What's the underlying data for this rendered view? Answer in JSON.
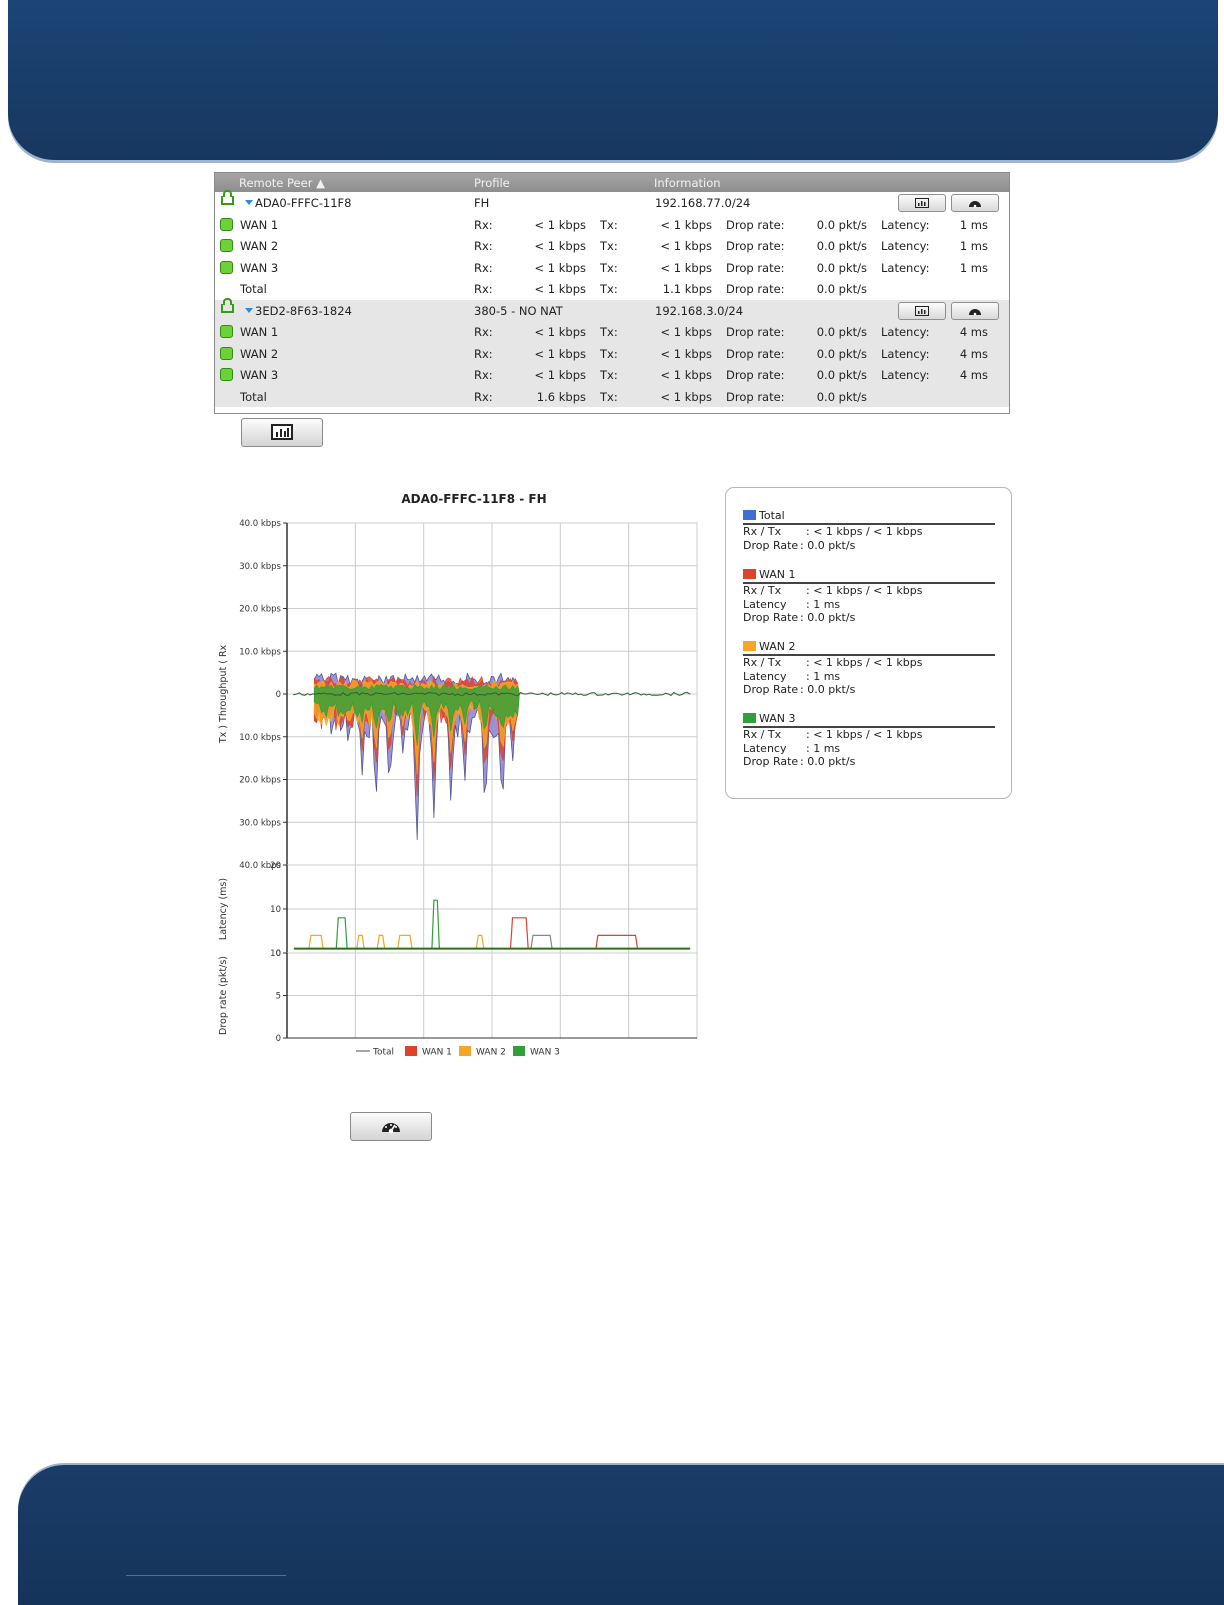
{
  "table": {
    "headers": [
      "Remote Peer",
      "Profile",
      "Information"
    ],
    "peers": [
      {
        "name": "ADA0-FFFC-11F8",
        "profile": "FH",
        "info": "192.168.77.0/24",
        "rows": [
          {
            "name": "WAN 1",
            "rx_label": "Rx:",
            "rx": "< 1 kbps",
            "tx_label": "Tx:",
            "tx": "< 1 kbps",
            "drop_label": "Drop rate:",
            "drop": "0.0 pkt/s",
            "lat_label": "Latency:",
            "lat": "1 ms"
          },
          {
            "name": "WAN 2",
            "rx_label": "Rx:",
            "rx": "< 1 kbps",
            "tx_label": "Tx:",
            "tx": "< 1 kbps",
            "drop_label": "Drop rate:",
            "drop": "0.0 pkt/s",
            "lat_label": "Latency:",
            "lat": "1 ms"
          },
          {
            "name": "WAN 3",
            "rx_label": "Rx:",
            "rx": "< 1 kbps",
            "tx_label": "Tx:",
            "tx": "< 1 kbps",
            "drop_label": "Drop rate:",
            "drop": "0.0 pkt/s",
            "lat_label": "Latency:",
            "lat": "1 ms"
          },
          {
            "name": "Total",
            "rx_label": "Rx:",
            "rx": "< 1 kbps",
            "tx_label": "Tx:",
            "tx": "1.1 kbps",
            "drop_label": "Drop rate:",
            "drop": "0.0 pkt/s",
            "lat_label": "",
            "lat": ""
          }
        ]
      },
      {
        "name": "3ED2-8F63-1824",
        "profile": "380-5 - NO NAT",
        "info": "192.168.3.0/24",
        "rows": [
          {
            "name": "WAN 1",
            "rx_label": "Rx:",
            "rx": "< 1 kbps",
            "tx_label": "Tx:",
            "tx": "< 1 kbps",
            "drop_label": "Drop rate:",
            "drop": "0.0 pkt/s",
            "lat_label": "Latency:",
            "lat": "4 ms"
          },
          {
            "name": "WAN 2",
            "rx_label": "Rx:",
            "rx": "< 1 kbps",
            "tx_label": "Tx:",
            "tx": "< 1 kbps",
            "drop_label": "Drop rate:",
            "drop": "0.0 pkt/s",
            "lat_label": "Latency:",
            "lat": "4 ms"
          },
          {
            "name": "WAN 3",
            "rx_label": "Rx:",
            "rx": "< 1 kbps",
            "tx_label": "Tx:",
            "tx": "< 1 kbps",
            "drop_label": "Drop rate:",
            "drop": "0.0 pkt/s",
            "lat_label": "Latency:",
            "lat": "4 ms"
          },
          {
            "name": "Total",
            "rx_label": "Rx:",
            "rx": "1.6 kbps",
            "tx_label": "Tx:",
            "tx": "< 1 kbps",
            "drop_label": "Drop rate:",
            "drop": "0.0 pkt/s",
            "lat_label": "",
            "lat": ""
          }
        ]
      }
    ]
  },
  "icons": {
    "chart_button": "bar-chart-icon",
    "gauge_button": "speedometer-icon"
  },
  "colors": {
    "total": "#4a6fcf",
    "wan1": "#e0412a",
    "wan2": "#f5a623",
    "wan3": "#2fa03a",
    "grid": "#cccccc"
  },
  "legend_panel": {
    "sections": [
      {
        "title": "Total",
        "color": "#3f6fd0",
        "lines": [
          {
            "k": "Rx / Tx",
            "v": ": < 1 kbps / < 1 kbps"
          },
          {
            "k": "Drop Rate",
            "v": ": 0.0 pkt/s",
            "inline": true
          }
        ]
      },
      {
        "title": "WAN 1",
        "color": "#e0412a",
        "lines": [
          {
            "k": "Rx / Tx",
            "v": ": < 1 kbps / < 1 kbps"
          },
          {
            "k": "Latency",
            "v": ": 1 ms"
          },
          {
            "k": "Drop Rate",
            "v": ": 0.0 pkt/s",
            "inline": true
          }
        ]
      },
      {
        "title": "WAN 2",
        "color": "#f5a623",
        "lines": [
          {
            "k": "Rx / Tx",
            "v": ": < 1 kbps / < 1 kbps"
          },
          {
            "k": "Latency",
            "v": ": 1 ms"
          },
          {
            "k": "Drop Rate",
            "v": ": 0.0 pkt/s",
            "inline": true
          }
        ]
      },
      {
        "title": "WAN 3",
        "color": "#2fa03a",
        "lines": [
          {
            "k": "Rx / Tx",
            "v": ": < 1 kbps / < 1 kbps"
          },
          {
            "k": "Latency",
            "v": ": 1 ms"
          },
          {
            "k": "Drop Rate",
            "v": ": 0.0 pkt/s",
            "inline": true
          }
        ]
      }
    ]
  },
  "chart_data": {
    "type": "area",
    "title": "ADA0-FFFC-11F8 - FH",
    "panels": [
      {
        "name": "throughput",
        "ylabel": "Tx ) Throughput ( Rx",
        "ylim": [
          -40,
          40
        ],
        "ytick_labels": [
          "40.0 kbps",
          "30.0 kbps",
          "20.0 kbps",
          "10.0 kbps",
          "0",
          "10.0 kbps",
          "20.0 kbps",
          "30.0 kbps",
          "40.0 kbps"
        ],
        "ytick_values": [
          40,
          30,
          20,
          10,
          0,
          -10,
          -20,
          -30,
          -40
        ],
        "x_range": [
          0,
          120
        ],
        "active_range": [
          8,
          68
        ],
        "negative_spikes": [
          {
            "x": 18,
            "y": -13,
            "series": "Total"
          },
          {
            "x": 22,
            "y": -19,
            "series": "Total"
          },
          {
            "x": 26,
            "y": -27,
            "series": "Total"
          },
          {
            "x": 30,
            "y": -24,
            "series": "Total"
          },
          {
            "x": 34,
            "y": -15,
            "series": "Total"
          },
          {
            "x": 38,
            "y": -37,
            "series": "Total"
          },
          {
            "x": 43,
            "y": -29,
            "series": "Total"
          },
          {
            "x": 48,
            "y": -27,
            "series": "Total"
          },
          {
            "x": 52,
            "y": -22,
            "series": "Total"
          },
          {
            "x": 58,
            "y": -30,
            "series": "Total"
          },
          {
            "x": 63,
            "y": -29,
            "series": "Total"
          },
          {
            "x": 66,
            "y": -17,
            "series": "Total"
          }
        ],
        "positive_peak": 5
      },
      {
        "name": "latency",
        "ylabel": "Latency (ms)",
        "ylim": [
          0,
          20
        ],
        "ytick_labels": [
          "20",
          "10",
          "0"
        ],
        "ytick_values": [
          20,
          10,
          0
        ],
        "baseline": 1,
        "events": [
          {
            "x": 7,
            "width": 3,
            "y": 4,
            "series": "WAN 2"
          },
          {
            "x": 15,
            "width": 2,
            "y": 8,
            "series": "WAN 3"
          },
          {
            "x": 21,
            "width": 1,
            "y": 4,
            "series": "WAN 2"
          },
          {
            "x": 27,
            "width": 1,
            "y": 4,
            "series": "WAN 2"
          },
          {
            "x": 33,
            "width": 3,
            "y": 4,
            "series": "WAN 2"
          },
          {
            "x": 43,
            "width": 1,
            "y": 12,
            "series": "WAN 3"
          },
          {
            "x": 56,
            "width": 1,
            "y": 4,
            "series": "WAN 2"
          },
          {
            "x": 66,
            "width": 4,
            "y": 8,
            "series": "WAN 1"
          },
          {
            "x": 72,
            "width": 5,
            "y": 4,
            "series": "Total"
          },
          {
            "x": 91,
            "width": 11,
            "y": 4,
            "series": "WAN 1"
          }
        ]
      },
      {
        "name": "drop",
        "ylabel": "Drop rate (pkt/s)",
        "ylim": [
          0,
          10
        ],
        "ytick_labels": [
          "10",
          "5",
          "0"
        ],
        "ytick_values": [
          10,
          5,
          0
        ]
      }
    ],
    "series": [
      {
        "name": "Total",
        "color": "#888888"
      },
      {
        "name": "WAN 1",
        "color": "#e0412a"
      },
      {
        "name": "WAN 2",
        "color": "#f5a623"
      },
      {
        "name": "WAN 3",
        "color": "#2fa03a"
      }
    ],
    "grid": true,
    "legend_position": "bottom"
  }
}
